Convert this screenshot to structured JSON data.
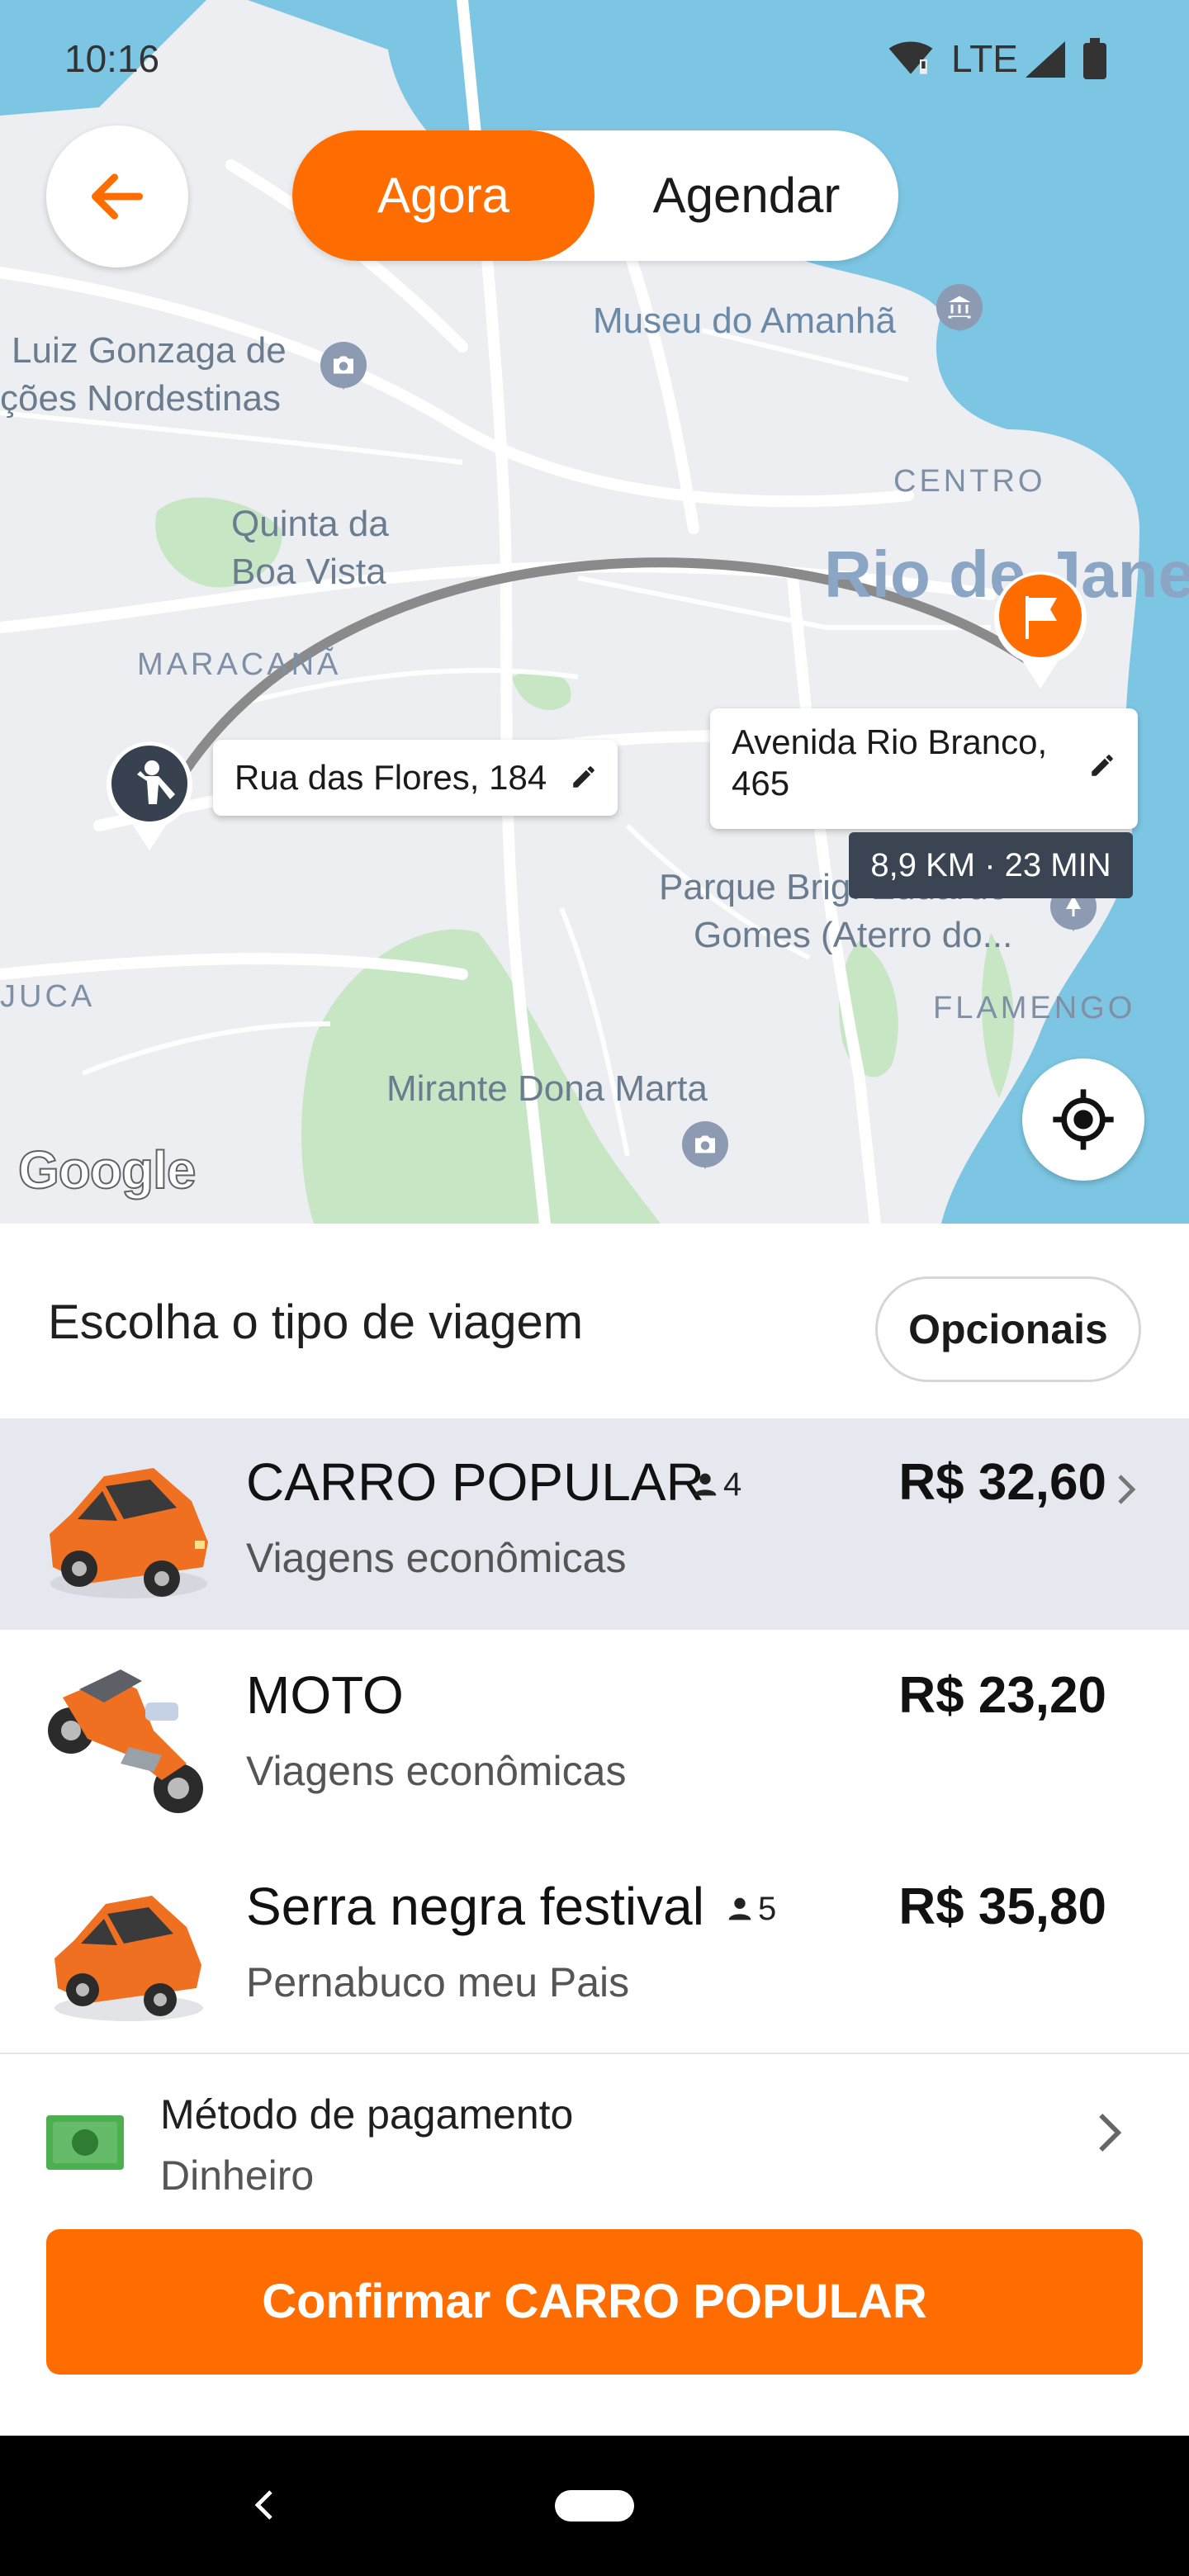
{
  "status_bar": {
    "time": "10:16",
    "network": "LTE"
  },
  "top_controls": {
    "mode_now": "Agora",
    "mode_schedule": "Agendar",
    "selected_mode": "Agora"
  },
  "map": {
    "labels": {
      "museu": "Museu do Amanhã",
      "gonzaga_1": "Luiz Gonzaga de",
      "gonzaga_2": "ções Nordestinas",
      "quinta_1": "Quinta da",
      "quinta_2": "Boa Vista",
      "centro": "CENTRO",
      "rio": "Rio de Jane",
      "maracana": "MARACANÃ",
      "parque_1": "Parque Brig. Eduardo",
      "parque_2": "Gomes (Aterro do...",
      "juca": "JUCA",
      "flamengo": "FLAMENGO",
      "mirante": "Mirante Dona Marta"
    },
    "origin_address": "Rua das Flores, 184",
    "destination_address": "Avenida Rio Branco, 465",
    "trip_summary": "8,9 KM · 23 MIN",
    "attribution": "Google"
  },
  "sheet": {
    "title": "Escolha o tipo de viagem",
    "options_label": "Opcionais",
    "rides": [
      {
        "name": "CARRO POPULAR",
        "capacity": "4",
        "description": "Viagens econômicas",
        "price": "R$ 32,60",
        "selected": true,
        "icon": "car-icon"
      },
      {
        "name": "MOTO",
        "capacity": "",
        "description": "Viagens econômicas",
        "price": "R$ 23,20",
        "selected": false,
        "icon": "motorcycle-icon"
      },
      {
        "name": "Serra negra festival",
        "capacity": "5",
        "description": "Pernabuco meu Pais",
        "price": "R$ 35,80",
        "selected": false,
        "icon": "car-icon"
      }
    ],
    "payment": {
      "label": "Método de pagamento",
      "value": "Dinheiro",
      "icon": "cash-icon"
    },
    "confirm_label": "Confirmar CARRO POPULAR"
  },
  "colors": {
    "accent": "#ff6d00",
    "selected_row": "#e6e8f0",
    "water": "#7cc6e3"
  }
}
